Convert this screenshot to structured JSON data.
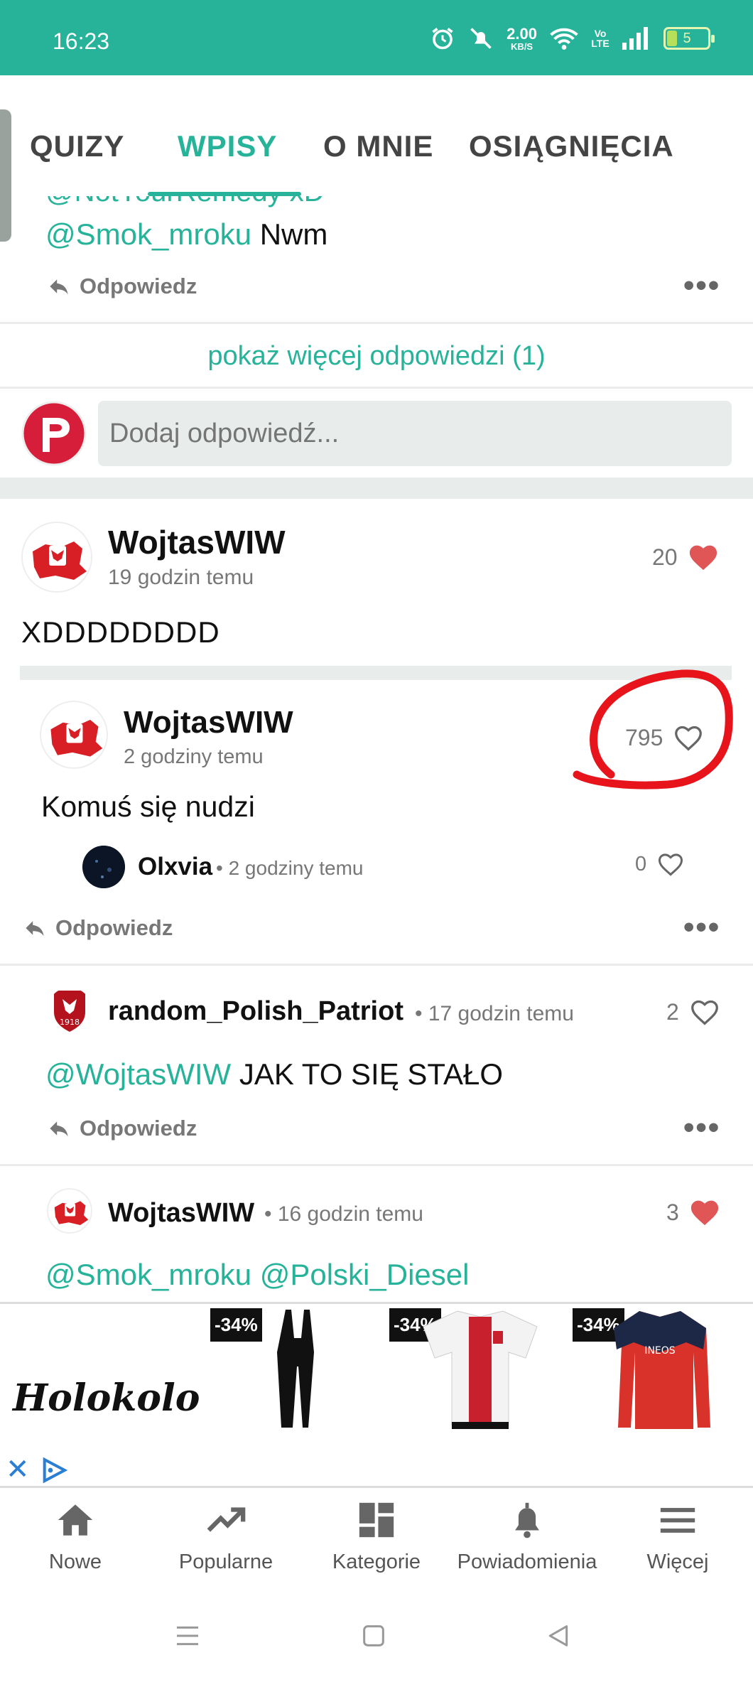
{
  "status_bar": {
    "time": "16:23",
    "net_speed": "2.00",
    "net_unit": "KB/S",
    "battery": "5",
    "volte": "Vo LTE"
  },
  "tabs": [
    {
      "label": "QUIZY"
    },
    {
      "label": "WPISY",
      "active": true
    },
    {
      "label": "O MNIE"
    },
    {
      "label": "OSIĄGNIĘCIA"
    }
  ],
  "thread_top": {
    "partial_mention": "@NotYourRemedy xD",
    "mention": "@Smok_mroku",
    "text": " Nwm",
    "reply_label": "Odpowiedz",
    "more": "•••"
  },
  "show_more_label": "pokaż więcej odpowiedzi (1)",
  "add_reply_placeholder": "Dodaj odpowiedź...",
  "post": {
    "username": "WojtasWIW",
    "time": "19 godzin temu",
    "likes": "20",
    "text": "XDDDDDDDD",
    "quoted": {
      "username": "WojtasWIW",
      "time": "2 godziny temu",
      "likes": "795",
      "text": "Komuś się nudzi",
      "comment_user": "Olxvia",
      "comment_time": "• 2 godziny temu",
      "comment_likes": "0"
    },
    "reply_label": "Odpowiedz",
    "more": "•••"
  },
  "replies": [
    {
      "username": "random_Polish_Patriot",
      "time": "• 17 godzin temu",
      "likes": "2",
      "mention": "@WojtasWIW",
      "text": " JAK TO SIĘ STAŁO",
      "reply_label": "Odpowiedz",
      "more": "•••"
    },
    {
      "username": "WojtasWIW",
      "time": "• 16 godzin temu",
      "likes": "3",
      "mention": "@Smok_mroku @Polski_Diesel",
      "text": ""
    }
  ],
  "ad": {
    "brand": "Holokolo",
    "badges": [
      "-34%",
      "-34%",
      "-34%"
    ],
    "jersey_text": "INEOS"
  },
  "bottom_nav": [
    {
      "label": "Nowe",
      "icon": "home-icon"
    },
    {
      "label": "Popularne",
      "icon": "trending-icon"
    },
    {
      "label": "Kategorie",
      "icon": "grid-icon"
    },
    {
      "label": "Powiadomienia",
      "icon": "bell-icon"
    },
    {
      "label": "Więcej",
      "icon": "menu-icon"
    }
  ],
  "colors": {
    "accent": "#27b39a",
    "heart": "#e05555",
    "annotation": "#e8141b"
  }
}
